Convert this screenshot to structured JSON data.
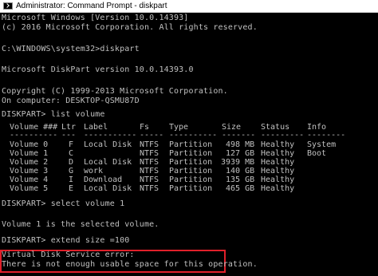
{
  "window": {
    "title": "Administrator: Command Prompt - diskpart",
    "icon": "cmd-icon"
  },
  "console": {
    "header1": "Microsoft Windows [Version 10.0.14393]",
    "header2": "(c) 2016 Microsoft Corporation. All rights reserved.",
    "cmd_diskpart": "C:\\WINDOWS\\system32>diskpart",
    "diskpart_version": "Microsoft DiskPart version 10.0.14393.0",
    "copyright": "Copyright (C) 1999-2013 Microsoft Corporation.",
    "computer": "On computer: DESKTOP-QSMU87D",
    "cmd_list": "DISKPART> list volume",
    "cmd_select": "DISKPART> select volume 1",
    "selected_msg": "Volume 1 is the selected volume.",
    "cmd_extend": "DISKPART> extend size =100",
    "error_line1": "Virtual Disk Service error:",
    "error_line2": "There is not enough usable space for this operation."
  },
  "volume_table": {
    "headers": {
      "volume": "Volume ###",
      "ltr": "Ltr",
      "label": "Label",
      "fs": "Fs",
      "type": "Type",
      "size": "Size",
      "status": "Status",
      "info": "Info"
    },
    "separators": {
      "volume": "----------",
      "ltr": "---",
      "label": "-----------",
      "fs": "-----",
      "type": "----------",
      "size": "-------",
      "status": "---------",
      "info": "--------"
    },
    "rows": [
      {
        "volume": "Volume 0",
        "ltr": "F",
        "label": "Local Disk",
        "fs": "NTFS",
        "type": "Partition",
        "size": "498 MB",
        "status": "Healthy",
        "info": "System"
      },
      {
        "volume": "Volume 1",
        "ltr": "C",
        "label": "",
        "fs": "NTFS",
        "type": "Partition",
        "size": "127 GB",
        "status": "Healthy",
        "info": "Boot"
      },
      {
        "volume": "Volume 2",
        "ltr": "D",
        "label": "Local Disk",
        "fs": "NTFS",
        "type": "Partition",
        "size": "3939 MB",
        "status": "Healthy",
        "info": ""
      },
      {
        "volume": "Volume 3",
        "ltr": "G",
        "label": "work",
        "fs": "NTFS",
        "type": "Partition",
        "size": "140 GB",
        "status": "Healthy",
        "info": ""
      },
      {
        "volume": "Volume 4",
        "ltr": "I",
        "label": "Download",
        "fs": "NTFS",
        "type": "Partition",
        "size": "135 GB",
        "status": "Healthy",
        "info": ""
      },
      {
        "volume": "Volume 5",
        "ltr": "E",
        "label": "Local Disk",
        "fs": "NTFS",
        "type": "Partition",
        "size": "465 GB",
        "status": "Healthy",
        "info": ""
      }
    ]
  },
  "colors": {
    "console_bg": "#000000",
    "console_text": "#c0c0c0",
    "highlight_border": "#e0202a"
  }
}
